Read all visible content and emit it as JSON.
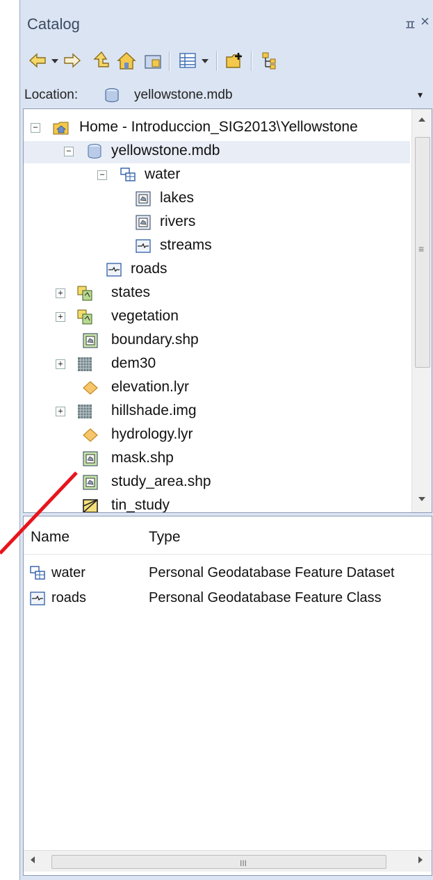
{
  "window": {
    "title": "Catalog",
    "pin_glyph": "ㅍ",
    "close_glyph": "×"
  },
  "toolbar": {
    "items": [
      "back-arrow-icon",
      "dropdown-icon",
      "forward-arrow-icon",
      "up-one-level-icon",
      "home-folder-icon",
      "connect-folder-icon",
      "view-options-icon",
      "dropdown-icon",
      "add-data-icon",
      "tree-view-icon"
    ]
  },
  "location": {
    "label": "Location:",
    "value": "yellowstone.mdb",
    "dropdown_glyph": "▾"
  },
  "tree": {
    "items": [
      {
        "label": "Home - Introduccion_SIG2013\\Yellowstone",
        "icon": "home-folder-icon",
        "expander": "⊟"
      },
      {
        "label": "yellowstone.mdb",
        "icon": "geodatabase-icon",
        "expander": "⊟",
        "selected": true
      },
      {
        "label": "water",
        "icon": "feature-dataset-icon",
        "expander": "⊟"
      },
      {
        "label": "lakes",
        "icon": "polygon-feature-class-icon"
      },
      {
        "label": "rivers",
        "icon": "polygon-feature-class-icon"
      },
      {
        "label": "streams",
        "icon": "line-feature-class-icon"
      },
      {
        "label": "roads",
        "icon": "line-feature-class-icon"
      },
      {
        "label": "states",
        "icon": "coverage-icon",
        "expander": "⊞"
      },
      {
        "label": "vegetation",
        "icon": "coverage-icon",
        "expander": "⊞"
      },
      {
        "label": "boundary.shp",
        "icon": "polygon-shapefile-icon"
      },
      {
        "label": "dem30",
        "icon": "raster-icon",
        "expander": "⊞"
      },
      {
        "label": "elevation.lyr",
        "icon": "layer-file-icon"
      },
      {
        "label": "hillshade.img",
        "icon": "raster-icon",
        "expander": "⊞"
      },
      {
        "label": "hydrology.lyr",
        "icon": "layer-file-icon"
      },
      {
        "label": "mask.shp",
        "icon": "polygon-shapefile-icon"
      },
      {
        "label": "study_area.shp",
        "icon": "polygon-shapefile-icon"
      },
      {
        "label": "tin_study",
        "icon": "tin-icon"
      }
    ]
  },
  "list": {
    "columns": [
      "Name",
      "Type"
    ],
    "rows": [
      {
        "name": "water",
        "type": "Personal Geodatabase Feature Dataset",
        "icon": "feature-dataset-icon"
      },
      {
        "name": "roads",
        "type": "Personal Geodatabase Feature Class",
        "icon": "line-feature-class-icon"
      }
    ]
  },
  "scrollbars": {
    "grip_vertical": "≡",
    "grip_horizontal": "III"
  },
  "colors": {
    "panel": "#dbe4f2",
    "annotation_arrow": "#e8141c"
  }
}
